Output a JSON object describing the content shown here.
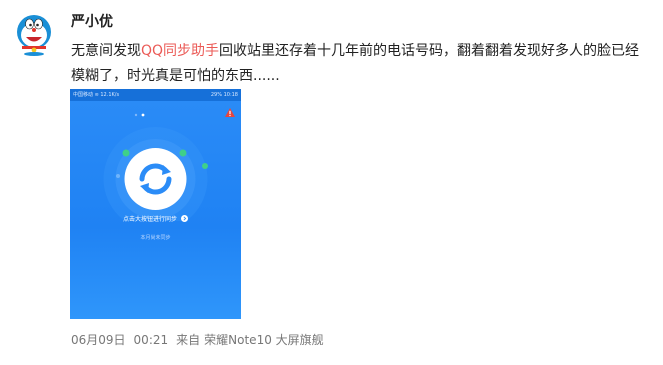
{
  "post": {
    "username": "严小优",
    "text_before": "无意间发现",
    "text_highlight": "QQ同步助手",
    "text_after": "回收站里还存着十几年前的电话号码，翻着翻着发现好多人的脸已经模糊了，时光真是可怕的东西......",
    "highlight_color": "#eb5a56"
  },
  "screenshot": {
    "status_left": "中国移动 ≋ 12.1K/s",
    "status_right": "29% 10:18",
    "main_text": "点击大按钮进行同步",
    "sub_text": "本月尚未同步",
    "accent": "#2b8cf7"
  },
  "meta": {
    "date": "06月09日",
    "time": "00:21",
    "source_prefix": "来自",
    "device": "荣耀Note10 大屏旗舰"
  }
}
